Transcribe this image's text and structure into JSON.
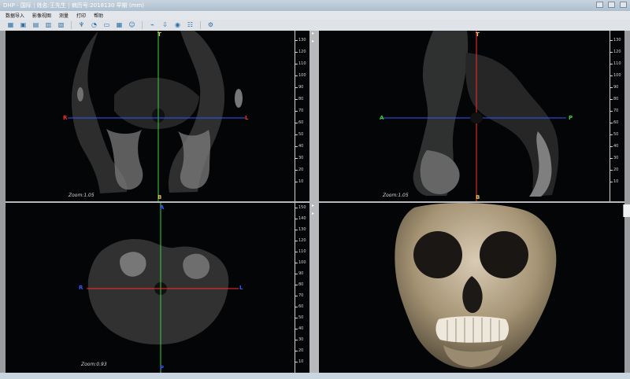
{
  "window": {
    "title_left": "DHP - 国际",
    "title_mid": "姓名:王先生",
    "title_right": "病历号:2018130 早期",
    "title_suffix": "(mm)"
  },
  "menu": [
    "数据导入",
    "影像视图",
    "测量",
    "打印",
    "帮助"
  ],
  "toolbar_icons": [
    "open-icon",
    "save-icon",
    "document-icon",
    "print-icon",
    "folder-icon",
    "tooth-icon",
    "teeth-icon",
    "ruler-icon",
    "grid-icon",
    "face-icon",
    "measure-icon",
    "export-icon",
    "camera-icon",
    "layers-icon",
    "settings-icon"
  ],
  "views": {
    "coronal": {
      "zoom": "Zoom:1.05",
      "labels": {
        "top": "T",
        "left": "R",
        "right": "L",
        "bottom": "B"
      }
    },
    "sagittal": {
      "zoom": "Zoom:1.05",
      "labels": {
        "top": "T",
        "left": "A",
        "right": "P",
        "bottom": "B"
      }
    },
    "axial": {
      "zoom": "Zoom:0.93",
      "labels": {
        "top": "A",
        "left": "R",
        "right": "L",
        "bottom": "P"
      }
    }
  },
  "ruler_labels": [
    "130",
    "120",
    "110",
    "100",
    "90",
    "80",
    "70",
    "60",
    "50",
    "40",
    "30",
    "20",
    "10"
  ],
  "ruler_labels_axial": [
    "150",
    "140",
    "130",
    "120",
    "110",
    "100",
    "90",
    "80",
    "70",
    "60",
    "50",
    "40",
    "30",
    "20",
    "10"
  ],
  "colors": {
    "red": "#ff2a2a",
    "green": "#35d43d",
    "blue": "#3159ff",
    "yellow": "#e9c547"
  }
}
